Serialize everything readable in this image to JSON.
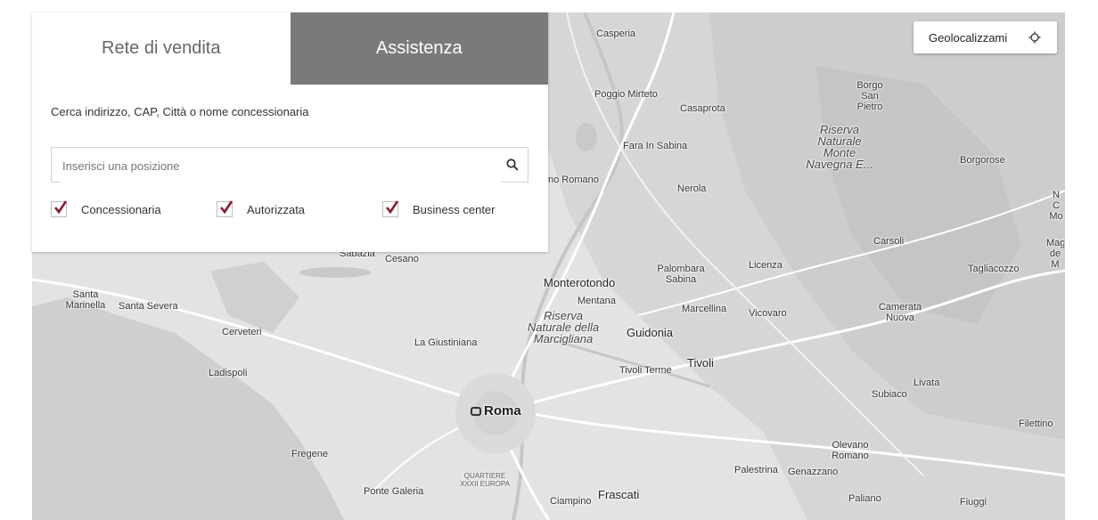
{
  "tabs": {
    "sales": "Rete di vendita",
    "assistance": "Assistenza"
  },
  "search": {
    "hint": "Cerca indirizzo, CAP, Città o nome concessionaria",
    "placeholder": "Inserisci una posizione",
    "icon": "search-icon"
  },
  "filters": [
    {
      "label": "Concessionaria",
      "checked": true
    },
    {
      "label": "Autorizzata",
      "checked": true
    },
    {
      "label": "Business center",
      "checked": true
    }
  ],
  "geolocate": {
    "label": "Geolocalizzami",
    "icon": "crosshair-icon"
  },
  "colors": {
    "check": "#8b1a2b",
    "tab_inactive": "#7a7a7a",
    "map": "#e3e3e3"
  },
  "places": [
    "Casperia",
    "Borgo San Pietro",
    "Poggio Mirteto",
    "Casaprota",
    "Riserva Naturale Monte Navegna E...",
    "Fara In Sabina",
    "Borgorose",
    "no Romano",
    "Nerola",
    "Carsoli",
    "Sabazia",
    "Cesano",
    "Palombara Sabina",
    "Licenza",
    "Tagliacozzo",
    "Monterotondo",
    "Mentana",
    "Santa Marinella",
    "Santa Severa",
    "Riserva Naturale della Marcigliana",
    "Marcellina",
    "Vicovaro",
    "Camerata Nuova",
    "Cerveteri",
    "Guidonia",
    "La Giustiniana",
    "Tivoli Terme",
    "Tivoli",
    "Ladispoli",
    "Livata",
    "Subiaco",
    "Roma",
    "Filettino",
    "Fregene",
    "Olevano Romano",
    "QUARTIERE XXXII EUROPA",
    "Palestrina",
    "Genazzano",
    "Ponte Galeria",
    "Frascati",
    "Ciampino",
    "Paliano",
    "Fiuggi",
    "Mag de M",
    "N C Mo"
  ]
}
